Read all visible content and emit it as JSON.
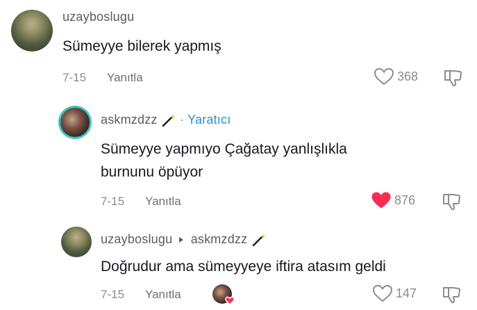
{
  "comments": [
    {
      "username": "uzayboslugu",
      "text": "Sümeyye bilerek yapmış",
      "date": "7-15",
      "reply_label": "Yanıtla",
      "likes": "368",
      "liked": false,
      "avatar_icon": "landscape-avatar"
    },
    {
      "username": "askmzdzz",
      "separator": "·",
      "badge": "Yaratıcı",
      "text_line1": "Sümeyye yapmıyo Çağatay yanlışlıkla",
      "text_line2": "burnunu öpüyor",
      "date": "7-15",
      "reply_label": "Yanıtla",
      "likes": "876",
      "liked": true,
      "avatar_icon": "couple-avatar"
    },
    {
      "username": "uzayboslugu",
      "reply_to": "askmzdzz",
      "text": "Doğrudur ama sümeyyeye iftira atasım geldi",
      "date": "7-15",
      "reply_label": "Yanıtla",
      "likes": "147",
      "liked": false,
      "avatar_icon": "landscape-avatar"
    }
  ],
  "colors": {
    "liked_heart": "#fe2c55",
    "creator_badge": "#2b8fc7",
    "avatar_ring": "#3ec6c6"
  }
}
